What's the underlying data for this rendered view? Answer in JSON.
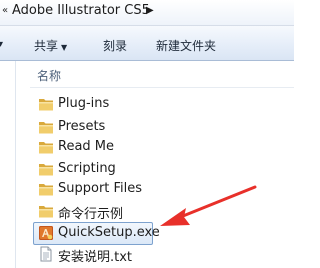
{
  "address_bar": {
    "path_label": "Adobe Illustrator CS5",
    "left_chevron": "«",
    "arrow": "▶"
  },
  "toolbar": {
    "left_chevron": "▾",
    "share_label": "共享",
    "share_dropdown": "▼",
    "burn_label": "刻录",
    "new_folder_label": "新建文件夹"
  },
  "column_header": {
    "name_label": "名称"
  },
  "files": [
    {
      "name": "Plug-ins",
      "icon": "folder-icon"
    },
    {
      "name": "Presets",
      "icon": "folder-icon"
    },
    {
      "name": "Read Me",
      "icon": "folder-icon"
    },
    {
      "name": "Scripting",
      "icon": "folder-icon"
    },
    {
      "name": "Support Files",
      "icon": "folder-icon"
    },
    {
      "name": "命令行示例",
      "icon": "folder-icon"
    },
    {
      "name": "QuickSetup.exe",
      "icon": "exe-icon",
      "selected": true
    },
    {
      "name": "安装说明.txt",
      "icon": "text-file-icon"
    }
  ],
  "colors": {
    "folder": "#e8c25a",
    "selection_border": "#7da2ce",
    "annotation_arrow": "#e8302a"
  }
}
